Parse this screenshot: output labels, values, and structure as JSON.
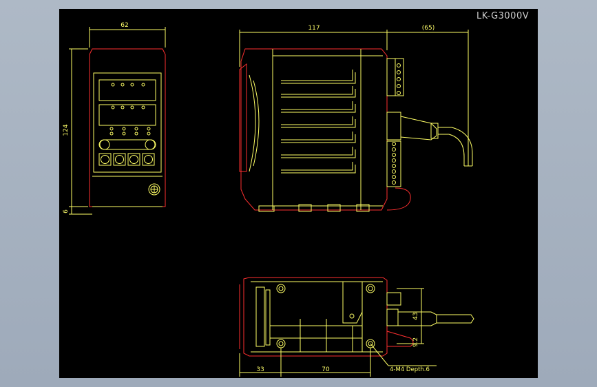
{
  "title": "LK-G3000V",
  "colors": {
    "background": "#000000",
    "outline": "#ff2a2a",
    "detail": "#ffff66",
    "frame": "#a8b4c4"
  },
  "dimensions": {
    "front_width": "62",
    "front_height": "124",
    "front_base": "6",
    "side_length": "117",
    "cable_length": "(65)",
    "bottom_left": "33",
    "bottom_mid": "70",
    "right_height": "43",
    "right_offset": "9.2",
    "mount_note": "4-M4 Depth.6"
  }
}
